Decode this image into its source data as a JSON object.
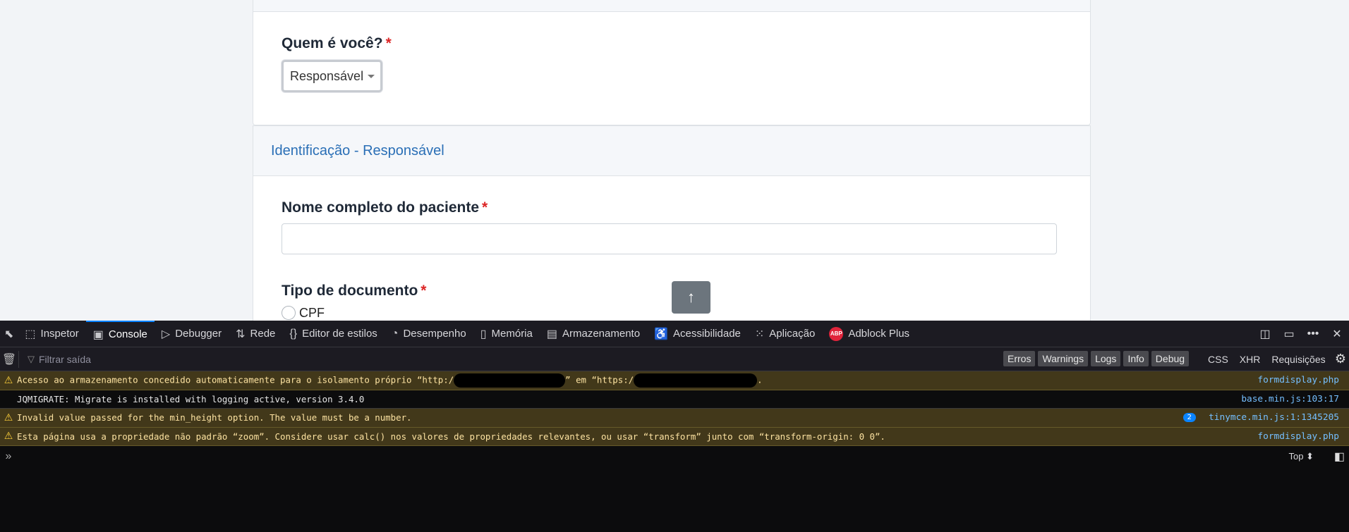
{
  "form": {
    "who_label": "Quem é você?",
    "required_mark": "*",
    "who_value": "Responsável",
    "section_title": "Identificação - Responsável",
    "patient_name_label": "Nome completo do paciente",
    "patient_name_value": "",
    "doc_type_label": "Tipo de documento",
    "doc_option_cpf": "CPF",
    "scroll_top_icon": "↑"
  },
  "devtools": {
    "tabs": [
      {
        "label": "Inspetor",
        "icon": "inspector-icon",
        "glyph": "⬚"
      },
      {
        "label": "Console",
        "icon": "console-icon",
        "glyph": "▣"
      },
      {
        "label": "Debugger",
        "icon": "debugger-icon",
        "glyph": "▷"
      },
      {
        "label": "Rede",
        "icon": "network-icon",
        "glyph": "⇅"
      },
      {
        "label": "Editor de estilos",
        "icon": "style-editor-icon",
        "glyph": "{}"
      },
      {
        "label": "Desempenho",
        "icon": "performance-icon",
        "glyph": "◔"
      },
      {
        "label": "Memória",
        "icon": "memory-icon",
        "glyph": "▯"
      },
      {
        "label": "Armazenamento",
        "icon": "storage-icon",
        "glyph": "▤"
      },
      {
        "label": "Acessibilidade",
        "icon": "accessibility-icon",
        "glyph": "♿"
      },
      {
        "label": "Aplicação",
        "icon": "application-icon",
        "glyph": "⁙"
      },
      {
        "label": "Adblock Plus",
        "icon": "adblock-icon",
        "glyph": "ABP"
      }
    ],
    "filter_placeholder": "Filtrar saída",
    "levels": [
      "Erros",
      "Warnings",
      "Logs",
      "Info",
      "Debug"
    ],
    "extra_filters": [
      "CSS",
      "XHR",
      "Requisições"
    ],
    "messages": [
      {
        "type": "warning",
        "text_a": "Acesso ao armazenamento concedido automaticamente para o isolamento próprio “http:/",
        "text_b": "” em “https:/",
        "text_c": ".",
        "source": "formdisplay.php"
      },
      {
        "type": "log",
        "text": "JQMIGRATE: Migrate is installed with logging active, version 3.4.0",
        "source": "base.min.js:103:17"
      },
      {
        "type": "warning",
        "text": "Invalid value passed for the min_height option. The value must be a number.",
        "count": "2",
        "source": "tinymce.min.js:1:1345205"
      },
      {
        "type": "warning",
        "text": "Esta página usa a propriedade não padrão “zoom”. Considere usar calc() nos valores de propriedades relevantes, ou usar “transform” junto com “transform-origin: 0 0”.",
        "source": "formdisplay.php"
      }
    ],
    "context_selector": "Top ⬍",
    "colors": {
      "accent": "#0a84ff",
      "warning_bg": "#42381a",
      "warning_text": "#fce2a1",
      "link": "#75bfff"
    }
  }
}
